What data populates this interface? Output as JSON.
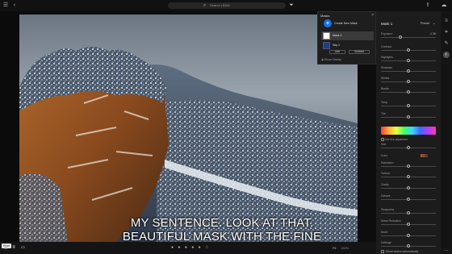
{
  "search": {
    "icon": "search-icon",
    "placeholder": "Search | BKM"
  },
  "topbar": {
    "menu_icon": "hamburger-icon",
    "back_icon": "back-arrow-icon",
    "filter_icon": "filter-icon",
    "share_icon": "share-icon",
    "cloud_icon": "cloud-icon"
  },
  "caption": {
    "line1": "MY SENTENCE. LOOK AT THAT.",
    "line2": "BEAUTIFUL MASK WITH THE FINE"
  },
  "masks_panel": {
    "title": "Masks",
    "create_label": "Create New Mask",
    "items": [
      {
        "label": "Mask 1",
        "selected": true
      },
      {
        "label": "Sky 1",
        "selected": false
      }
    ],
    "add_label": "Add",
    "subtract_label": "Subtract",
    "show_overlay_label": "Show Overlay"
  },
  "right_panel": {
    "title": "Mask 1",
    "preset_label": "Preset",
    "exposure_value": "-1.36",
    "sliders": [
      {
        "label": "Exposure",
        "pos": 0.35,
        "value": "-1.36"
      },
      {
        "label": "Contrast",
        "pos": 0.5
      },
      {
        "label": "Highlights",
        "pos": 0.5
      },
      {
        "label": "Shadows",
        "pos": 0.5
      },
      {
        "label": "Whites",
        "pos": 0.5
      },
      {
        "label": "Blacks",
        "pos": 0.5
      },
      {
        "label": "Temp",
        "pos": 0.5
      },
      {
        "label": "Tint",
        "pos": 0.5
      },
      {
        "label": "Hue",
        "pos": 0.5
      },
      {
        "label": "Saturation",
        "pos": 0.5
      },
      {
        "label": "Texture",
        "pos": 0.5
      },
      {
        "label": "Clarity",
        "pos": 0.5
      },
      {
        "label": "Dehaze",
        "pos": 0.5
      },
      {
        "label": "Sharpness",
        "pos": 0.5
      },
      {
        "label": "Noise Reduction",
        "pos": 0.5
      },
      {
        "label": "Moire",
        "pos": 0.5
      },
      {
        "label": "Defringe",
        "pos": 0.5
      }
    ],
    "use_fine_label": "Use fine adjustment",
    "color_label": "Color",
    "reset_label": "Reset sliders automatically"
  },
  "bottombar": {
    "pixel_label": "Pixel",
    "fit_label": "Fit",
    "zoom_label": "100%",
    "grid_icon": "grid-icon",
    "sort_icon": "sort-icon",
    "rect_icon": "rectangle-icon"
  },
  "right_toolbar": {
    "icons": [
      "edit-sliders-icon",
      "crop-icon",
      "healing-icon",
      "masking-icon",
      "more-icon"
    ]
  },
  "colors": {
    "accent": "#1473e6",
    "panel": "#1c1c1c",
    "selected_row": "#3a3a3a"
  }
}
